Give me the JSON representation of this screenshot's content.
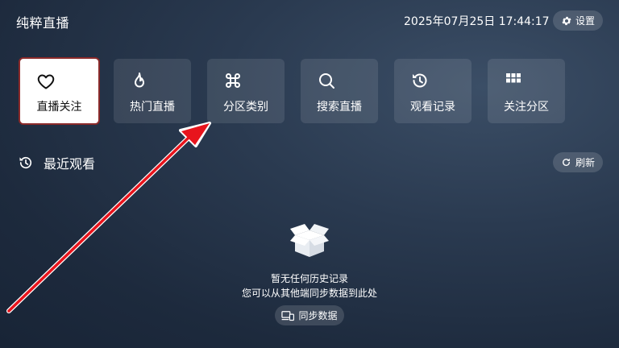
{
  "header": {
    "title": "纯粹直播",
    "datetime": "2025年07月25日 17:44:17",
    "settings_label": "设置",
    "settings_icon": "gear-icon"
  },
  "tiles": [
    {
      "label": "直播关注",
      "icon": "heart-icon",
      "active": true
    },
    {
      "label": "热门直播",
      "icon": "flame-icon",
      "active": false
    },
    {
      "label": "分区类别",
      "icon": "command-icon",
      "active": false
    },
    {
      "label": "搜索直播",
      "icon": "search-icon",
      "active": false
    },
    {
      "label": "观看记录",
      "icon": "history-icon",
      "active": false
    },
    {
      "label": "关注分区",
      "icon": "grid-icon",
      "active": false
    }
  ],
  "recent": {
    "title": "最近观看",
    "icon": "history-icon",
    "refresh_label": "刷新",
    "refresh_icon": "refresh-icon"
  },
  "empty_state": {
    "icon": "empty-box-icon",
    "title": "暂无任何历史记录",
    "subtitle": "您可以从其他端同步数据到此处",
    "sync_label": "同步数据",
    "sync_icon": "devices-icon"
  },
  "colors": {
    "active_border": "#8b2a2a",
    "arrow": "#e8141c"
  }
}
